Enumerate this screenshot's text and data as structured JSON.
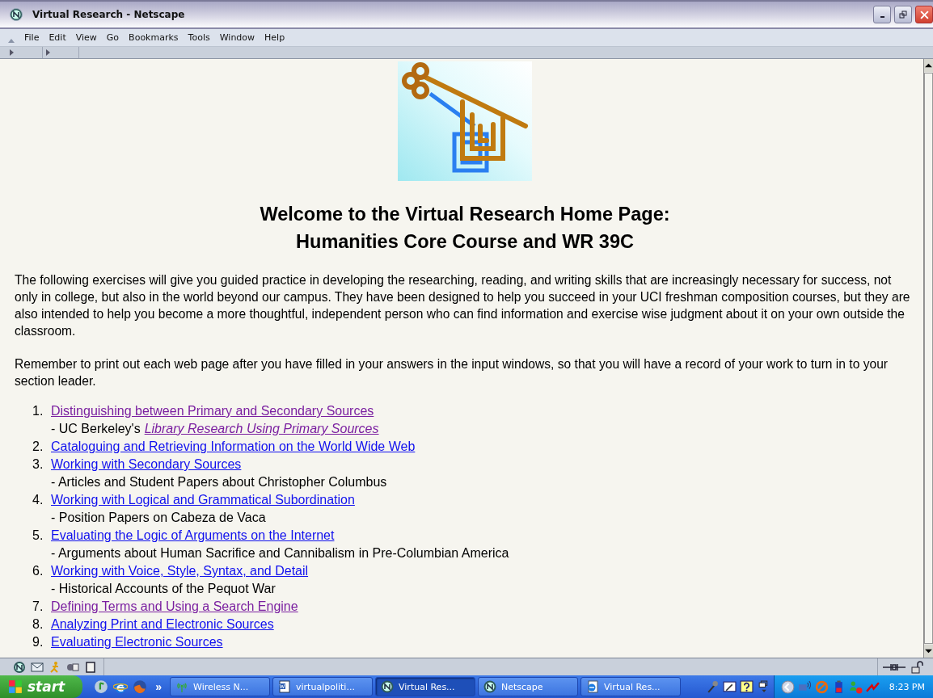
{
  "window": {
    "title": "Virtual Research - Netscape"
  },
  "menu": [
    "File",
    "Edit",
    "View",
    "Go",
    "Bookmarks",
    "Tools",
    "Window",
    "Help"
  ],
  "page": {
    "heading_lines": [
      "Welcome to the Virtual Research Home Page:",
      "Humanities Core Course and WR 39C"
    ],
    "paragraphs": [
      "The following exercises will give you guided practice in developing the researching, reading, and writing skills that are increasingly necessary for success, not only in college, but also in the world beyond our campus. They have been designed to help you succeed in your UCI freshman composition courses, but they are also intended to help you become a more thoughtful, independent person who can find information and exercise wise judgment about it on your own outside the classroom.",
      "Remember to print out each web page after you have filled in your answers in the input windows, so that you will have a record of your work to turn in to your section leader."
    ],
    "items": [
      {
        "number": "1.",
        "link": "Distinguishing between Primary and Secondary Sources",
        "visited": true,
        "note": "- UC Berkeley's",
        "note_link": "Library Research Using Primary Sources",
        "note_link_visited": true
      },
      {
        "number": "2.",
        "link": "Cataloguing and Retrieving Information on the World Wide Web",
        "visited": false
      },
      {
        "number": "3.",
        "link": "Working with Secondary Sources",
        "visited": false,
        "note": "- Articles and Student Papers about Christopher Columbus"
      },
      {
        "number": "4.",
        "link": "Working with Logical and Grammatical Subordination",
        "visited": false,
        "note": "- Position Papers on Cabeza de Vaca"
      },
      {
        "number": "5.",
        "link": "Evaluating the Logic of Arguments on the Internet",
        "visited": false,
        "note": "- Arguments about Human Sacrifice and Cannibalism in Pre-Columbian America"
      },
      {
        "number": "6.",
        "link": "Working with Voice, Style, Syntax, and Detail",
        "visited": false,
        "note": "- Historical Accounts of the Pequot War"
      },
      {
        "number": "7.",
        "link": "Defining Terms and Using a Search Engine",
        "visited": true
      },
      {
        "number": "8.",
        "link": "Analyzing Print and Electronic Sources",
        "visited": false
      },
      {
        "number": "9.",
        "link": "Evaluating Electronic Sources",
        "visited": false
      }
    ]
  },
  "taskbar": {
    "start": "start",
    "overflow": "»",
    "tasks": [
      {
        "kind": "wireless",
        "label": "Wireless N...",
        "selected": false
      },
      {
        "kind": "word",
        "label": "virtualpoliti...",
        "selected": false
      },
      {
        "kind": "netscape",
        "label": "Virtual Res...",
        "selected": true
      },
      {
        "kind": "netscape",
        "label": "Netscape",
        "selected": false
      },
      {
        "kind": "ie",
        "label": "Virtual Res...",
        "selected": false
      }
    ],
    "clock": "8:23 PM"
  }
}
